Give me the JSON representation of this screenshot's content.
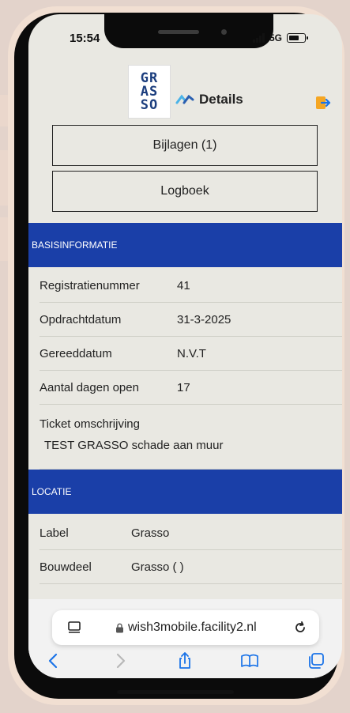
{
  "status": {
    "time": "15:54",
    "network": "5G"
  },
  "header": {
    "logo_lines": [
      "GR",
      "AS",
      "SO"
    ],
    "title": "Details"
  },
  "buttons": {
    "attachments": "Bijlagen (1)",
    "log": "Logboek"
  },
  "basic_info": {
    "title": "BASISINFORMATIE",
    "rows": [
      {
        "label": "Registratienummer",
        "value": "41"
      },
      {
        "label": "Opdrachtdatum",
        "value": "31-3-2025"
      },
      {
        "label": "Gereeddatum",
        "value": "N.V.T"
      },
      {
        "label": "Aantal dagen open",
        "value": "17"
      }
    ],
    "ticket_label": "Ticket omschrijving",
    "ticket_text": "TEST GRASSO schade aan muur"
  },
  "location": {
    "title": "LOCATIE",
    "rows": [
      {
        "label": "Label",
        "value": "Grasso"
      },
      {
        "label": "Bouwdeel",
        "value": "Grasso ( )"
      }
    ]
  },
  "browser": {
    "url": "wish3mobile.facility2.nl"
  },
  "colors": {
    "section_header": "#1a3fa8",
    "logo": "#1c3e7e",
    "browser_accent": "#1a73e8",
    "exit_icon": "#f5a623"
  }
}
